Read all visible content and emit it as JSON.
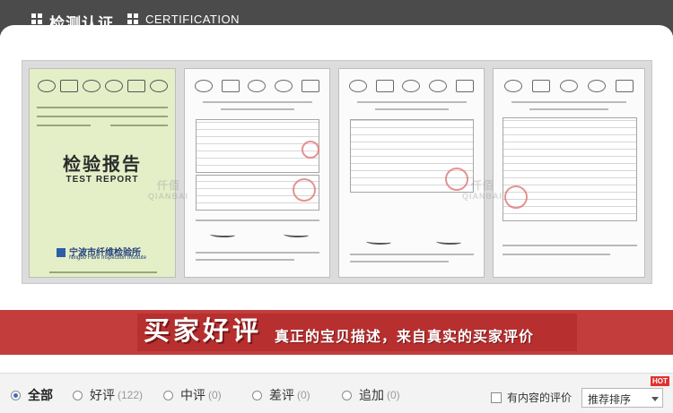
{
  "certification": {
    "title_cn": "检测认证",
    "title_en": "CERTIFICATION",
    "watermark_cn": "仟佰",
    "watermark_en": "QIANBAI",
    "report": {
      "title_cn": "检验报告",
      "title_en": "TEST REPORT",
      "institute_cn": "宁波市纤维检验所",
      "institute_en": "Ningbo Fibre Inspection Institute"
    }
  },
  "reviews_banner": {
    "title": "买家好评",
    "subtitle": "真正的宝贝描述，来自真实的买家评价"
  },
  "filter_bar": {
    "options": [
      {
        "label": "全部",
        "count": "",
        "selected": true
      },
      {
        "label": "好评",
        "count": "(122)",
        "selected": false
      },
      {
        "label": "中评",
        "count": "(0)",
        "selected": false
      },
      {
        "label": "差评",
        "count": "(0)",
        "selected": false
      },
      {
        "label": "追加",
        "count": "(0)",
        "selected": false
      }
    ],
    "has_content_label": "有内容的评价",
    "sort_label": "推荐排序",
    "hot_badge": "HOT"
  },
  "colors": {
    "header_bar": "#4b4b4b",
    "banner_red": "#c33d3d",
    "radio_accent": "#3a6fc4"
  }
}
